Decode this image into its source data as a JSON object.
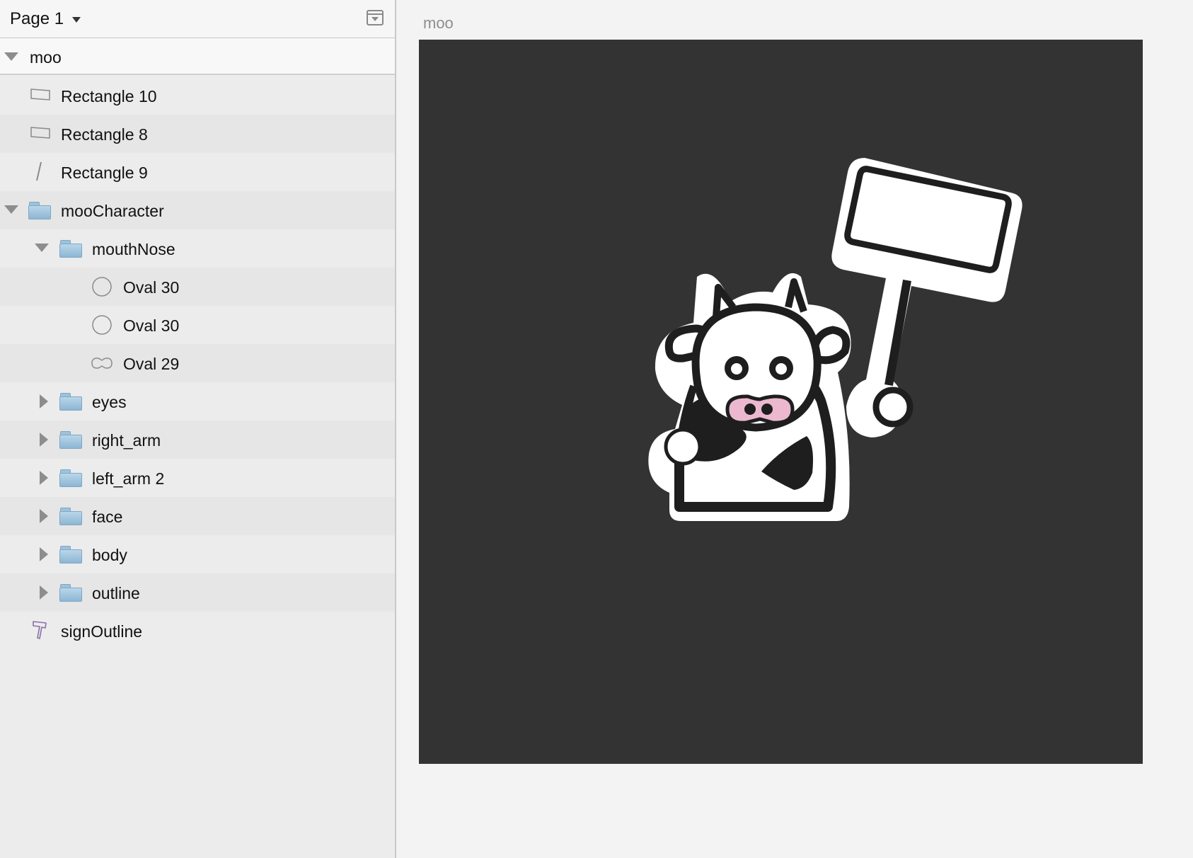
{
  "sidebar": {
    "page_label": "Page 1",
    "artboard_name": "moo",
    "layers": [
      {
        "label": "Rectangle 10",
        "icon": "rectangle-icon"
      },
      {
        "label": "Rectangle 8",
        "icon": "rectangle-icon"
      },
      {
        "label": "Rectangle 9",
        "icon": "line-icon"
      },
      {
        "label": "mooCharacter",
        "icon": "folder-icon",
        "expanded": true
      },
      {
        "label": "mouthNose",
        "icon": "folder-icon",
        "expanded": true
      },
      {
        "label": "Oval 30",
        "icon": "oval-icon"
      },
      {
        "label": "Oval 30",
        "icon": "oval-icon"
      },
      {
        "label": "Oval 29",
        "icon": "wide-oval-icon"
      },
      {
        "label": "eyes",
        "icon": "folder-icon",
        "expanded": false
      },
      {
        "label": "right_arm",
        "icon": "folder-icon",
        "expanded": false
      },
      {
        "label": "left_arm 2",
        "icon": "folder-icon",
        "expanded": false
      },
      {
        "label": "face",
        "icon": "folder-icon",
        "expanded": false
      },
      {
        "label": "body",
        "icon": "folder-icon",
        "expanded": false
      },
      {
        "label": "outline",
        "icon": "folder-icon",
        "expanded": false
      },
      {
        "label": "signOutline",
        "icon": "shape-path-icon"
      }
    ]
  },
  "canvas": {
    "artboard_title": "moo",
    "artboard_background": "#333333",
    "nose_color": "#ebb8cf"
  }
}
